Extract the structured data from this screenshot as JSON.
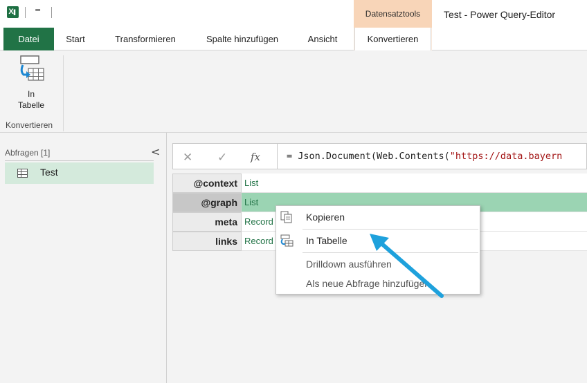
{
  "titlebar": {
    "app_icon": "excel-icon",
    "qat_arrow": "=",
    "context_tab_group": "Datensatztools",
    "window_title": "Test - Power Query-Editor"
  },
  "tabs": [
    {
      "label": "Datei"
    },
    {
      "label": "Start"
    },
    {
      "label": "Transformieren"
    },
    {
      "label": "Spalte hinzufügen"
    },
    {
      "label": "Ansicht"
    },
    {
      "label": "Konvertieren"
    }
  ],
  "ribbon": {
    "to_table_line1": "In",
    "to_table_line2": "Tabelle",
    "group_label": "Konvertieren"
  },
  "queries": {
    "header": "Abfragen [1]",
    "collapse_glyph": "<",
    "items": [
      {
        "label": "Test"
      }
    ]
  },
  "formula_bar": {
    "cancel_glyph": "✕",
    "confirm_glyph": "✓",
    "fx_glyph": "fx",
    "formula_prefix": "= Json.Document(Web.Contents(",
    "formula_string": "\"https://data.bayern"
  },
  "record": [
    {
      "key": "@context",
      "value": "List"
    },
    {
      "key": "@graph",
      "value": "List"
    },
    {
      "key": "meta",
      "value": "Record"
    },
    {
      "key": "links",
      "value": "Record"
    }
  ],
  "context_menu": {
    "items": [
      {
        "label": "Kopieren",
        "icon": "copy-icon"
      },
      {
        "label": "In Tabelle",
        "icon": "to-table-icon"
      },
      {
        "label": "Drilldown ausführen"
      },
      {
        "label": "Als neue Abfrage hinzufügen"
      }
    ]
  },
  "colors": {
    "excel_green": "#217346",
    "context_tab": "#f8d5b8",
    "selected_row": "#9bd4b3",
    "arrow": "#1ea1dc"
  }
}
